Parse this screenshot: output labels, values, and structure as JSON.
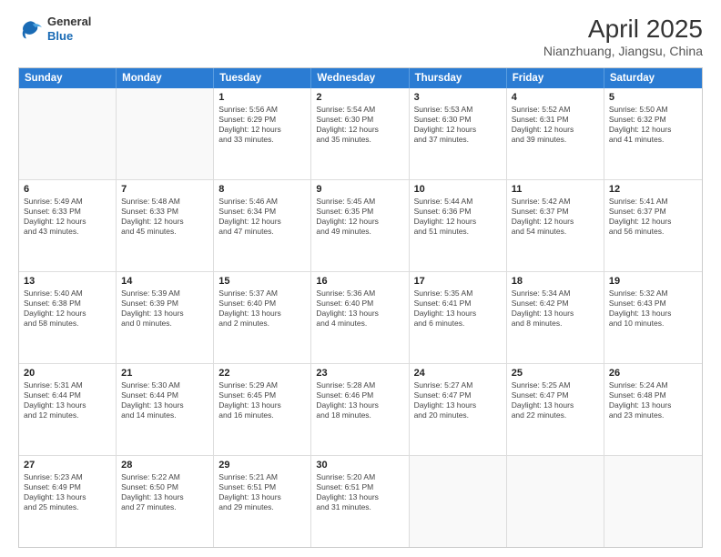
{
  "logo": {
    "general": "General",
    "blue": "Blue"
  },
  "title": "April 2025",
  "subtitle": "Nianzhuang, Jiangsu, China",
  "days": [
    "Sunday",
    "Monday",
    "Tuesday",
    "Wednesday",
    "Thursday",
    "Friday",
    "Saturday"
  ],
  "rows": [
    [
      {
        "day": "",
        "lines": []
      },
      {
        "day": "",
        "lines": []
      },
      {
        "day": "1",
        "lines": [
          "Sunrise: 5:56 AM",
          "Sunset: 6:29 PM",
          "Daylight: 12 hours",
          "and 33 minutes."
        ]
      },
      {
        "day": "2",
        "lines": [
          "Sunrise: 5:54 AM",
          "Sunset: 6:30 PM",
          "Daylight: 12 hours",
          "and 35 minutes."
        ]
      },
      {
        "day": "3",
        "lines": [
          "Sunrise: 5:53 AM",
          "Sunset: 6:30 PM",
          "Daylight: 12 hours",
          "and 37 minutes."
        ]
      },
      {
        "day": "4",
        "lines": [
          "Sunrise: 5:52 AM",
          "Sunset: 6:31 PM",
          "Daylight: 12 hours",
          "and 39 minutes."
        ]
      },
      {
        "day": "5",
        "lines": [
          "Sunrise: 5:50 AM",
          "Sunset: 6:32 PM",
          "Daylight: 12 hours",
          "and 41 minutes."
        ]
      }
    ],
    [
      {
        "day": "6",
        "lines": [
          "Sunrise: 5:49 AM",
          "Sunset: 6:33 PM",
          "Daylight: 12 hours",
          "and 43 minutes."
        ]
      },
      {
        "day": "7",
        "lines": [
          "Sunrise: 5:48 AM",
          "Sunset: 6:33 PM",
          "Daylight: 12 hours",
          "and 45 minutes."
        ]
      },
      {
        "day": "8",
        "lines": [
          "Sunrise: 5:46 AM",
          "Sunset: 6:34 PM",
          "Daylight: 12 hours",
          "and 47 minutes."
        ]
      },
      {
        "day": "9",
        "lines": [
          "Sunrise: 5:45 AM",
          "Sunset: 6:35 PM",
          "Daylight: 12 hours",
          "and 49 minutes."
        ]
      },
      {
        "day": "10",
        "lines": [
          "Sunrise: 5:44 AM",
          "Sunset: 6:36 PM",
          "Daylight: 12 hours",
          "and 51 minutes."
        ]
      },
      {
        "day": "11",
        "lines": [
          "Sunrise: 5:42 AM",
          "Sunset: 6:37 PM",
          "Daylight: 12 hours",
          "and 54 minutes."
        ]
      },
      {
        "day": "12",
        "lines": [
          "Sunrise: 5:41 AM",
          "Sunset: 6:37 PM",
          "Daylight: 12 hours",
          "and 56 minutes."
        ]
      }
    ],
    [
      {
        "day": "13",
        "lines": [
          "Sunrise: 5:40 AM",
          "Sunset: 6:38 PM",
          "Daylight: 12 hours",
          "and 58 minutes."
        ]
      },
      {
        "day": "14",
        "lines": [
          "Sunrise: 5:39 AM",
          "Sunset: 6:39 PM",
          "Daylight: 13 hours",
          "and 0 minutes."
        ]
      },
      {
        "day": "15",
        "lines": [
          "Sunrise: 5:37 AM",
          "Sunset: 6:40 PM",
          "Daylight: 13 hours",
          "and 2 minutes."
        ]
      },
      {
        "day": "16",
        "lines": [
          "Sunrise: 5:36 AM",
          "Sunset: 6:40 PM",
          "Daylight: 13 hours",
          "and 4 minutes."
        ]
      },
      {
        "day": "17",
        "lines": [
          "Sunrise: 5:35 AM",
          "Sunset: 6:41 PM",
          "Daylight: 13 hours",
          "and 6 minutes."
        ]
      },
      {
        "day": "18",
        "lines": [
          "Sunrise: 5:34 AM",
          "Sunset: 6:42 PM",
          "Daylight: 13 hours",
          "and 8 minutes."
        ]
      },
      {
        "day": "19",
        "lines": [
          "Sunrise: 5:32 AM",
          "Sunset: 6:43 PM",
          "Daylight: 13 hours",
          "and 10 minutes."
        ]
      }
    ],
    [
      {
        "day": "20",
        "lines": [
          "Sunrise: 5:31 AM",
          "Sunset: 6:44 PM",
          "Daylight: 13 hours",
          "and 12 minutes."
        ]
      },
      {
        "day": "21",
        "lines": [
          "Sunrise: 5:30 AM",
          "Sunset: 6:44 PM",
          "Daylight: 13 hours",
          "and 14 minutes."
        ]
      },
      {
        "day": "22",
        "lines": [
          "Sunrise: 5:29 AM",
          "Sunset: 6:45 PM",
          "Daylight: 13 hours",
          "and 16 minutes."
        ]
      },
      {
        "day": "23",
        "lines": [
          "Sunrise: 5:28 AM",
          "Sunset: 6:46 PM",
          "Daylight: 13 hours",
          "and 18 minutes."
        ]
      },
      {
        "day": "24",
        "lines": [
          "Sunrise: 5:27 AM",
          "Sunset: 6:47 PM",
          "Daylight: 13 hours",
          "and 20 minutes."
        ]
      },
      {
        "day": "25",
        "lines": [
          "Sunrise: 5:25 AM",
          "Sunset: 6:47 PM",
          "Daylight: 13 hours",
          "and 22 minutes."
        ]
      },
      {
        "day": "26",
        "lines": [
          "Sunrise: 5:24 AM",
          "Sunset: 6:48 PM",
          "Daylight: 13 hours",
          "and 23 minutes."
        ]
      }
    ],
    [
      {
        "day": "27",
        "lines": [
          "Sunrise: 5:23 AM",
          "Sunset: 6:49 PM",
          "Daylight: 13 hours",
          "and 25 minutes."
        ]
      },
      {
        "day": "28",
        "lines": [
          "Sunrise: 5:22 AM",
          "Sunset: 6:50 PM",
          "Daylight: 13 hours",
          "and 27 minutes."
        ]
      },
      {
        "day": "29",
        "lines": [
          "Sunrise: 5:21 AM",
          "Sunset: 6:51 PM",
          "Daylight: 13 hours",
          "and 29 minutes."
        ]
      },
      {
        "day": "30",
        "lines": [
          "Sunrise: 5:20 AM",
          "Sunset: 6:51 PM",
          "Daylight: 13 hours",
          "and 31 minutes."
        ]
      },
      {
        "day": "",
        "lines": []
      },
      {
        "day": "",
        "lines": []
      },
      {
        "day": "",
        "lines": []
      }
    ]
  ]
}
